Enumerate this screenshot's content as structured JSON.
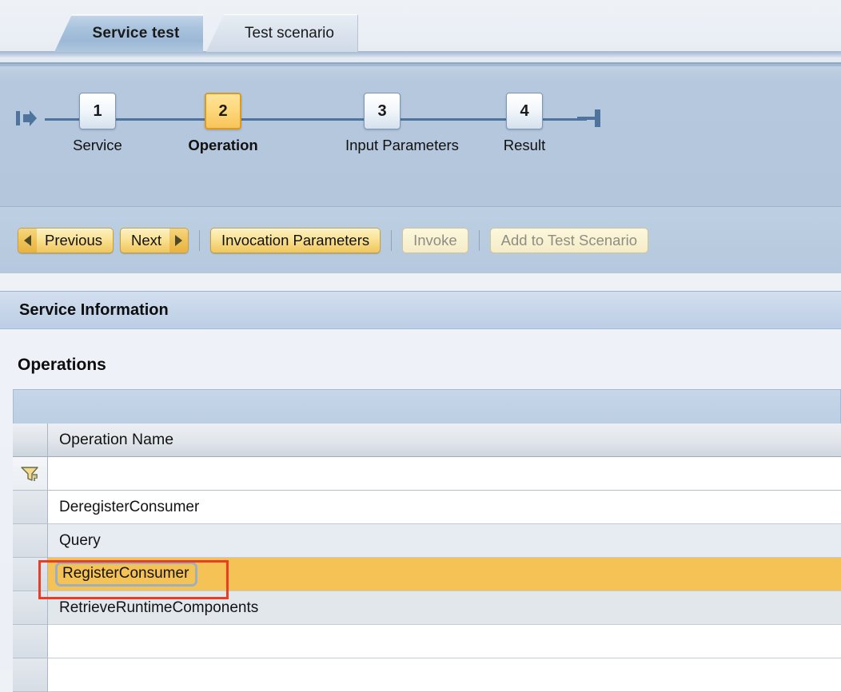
{
  "tabs": [
    {
      "label": "Service test",
      "active": true
    },
    {
      "label": "Test scenario",
      "active": false
    }
  ],
  "wizard": {
    "start_icon": "flow-start-icon",
    "end_icon": "flow-end-icon",
    "steps": [
      {
        "number": "1",
        "label": "Service",
        "active": false
      },
      {
        "number": "2",
        "label": "Operation",
        "active": true
      },
      {
        "number": "3",
        "label": "Input Parameters",
        "active": false
      },
      {
        "number": "4",
        "label": "Result",
        "active": false
      }
    ]
  },
  "toolbar": {
    "previous_label": "Previous",
    "next_label": "Next",
    "invocation_parameters_label": "Invocation Parameters",
    "invoke_label": "Invoke",
    "add_to_test_scenario_label": "Add to Test Scenario",
    "prev_arrow_icon": "triangle-left-icon",
    "next_arrow_icon": "triangle-right-icon"
  },
  "section": {
    "title": "Service Information"
  },
  "operations": {
    "heading": "Operations",
    "filter_icon": "filter-funnel-icon",
    "columns": [
      "Operation Name"
    ],
    "filter_value": "",
    "rows": [
      {
        "name": "DeregisterConsumer",
        "selected": false
      },
      {
        "name": "Query",
        "selected": false
      },
      {
        "name": "RegisterConsumer",
        "selected": true
      },
      {
        "name": "RetrieveRuntimeComponents",
        "selected": false
      },
      {
        "name": "",
        "selected": false
      },
      {
        "name": "",
        "selected": false
      }
    ]
  },
  "annotation": {
    "target": "RegisterConsumer",
    "color": "#ee3b24"
  },
  "colors": {
    "panel_blue": "#b4c7dd",
    "selection_orange": "#f5c255",
    "active_step_yellow": "#f8c45a",
    "button_gold": "#f5d274",
    "annotation_red": "#ee3b24"
  }
}
